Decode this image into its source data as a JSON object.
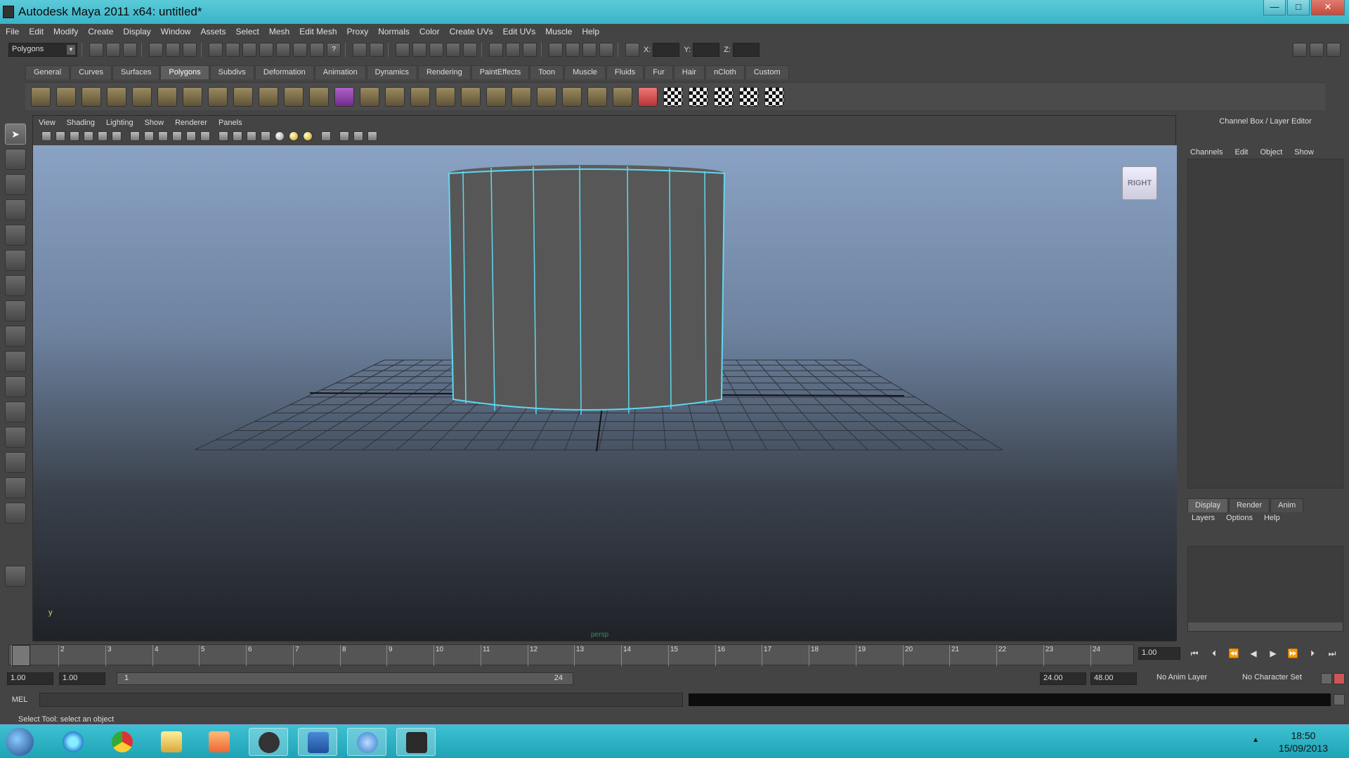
{
  "window": {
    "title": "Autodesk Maya 2011 x64: untitled*",
    "controls": {
      "minimize": "—",
      "maximize": "□",
      "close": "✕"
    }
  },
  "menubar": [
    "File",
    "Edit",
    "Modify",
    "Create",
    "Display",
    "Window",
    "Assets",
    "Select",
    "Mesh",
    "Edit Mesh",
    "Proxy",
    "Normals",
    "Color",
    "Create UVs",
    "Edit UVs",
    "Muscle",
    "Help"
  ],
  "statusline": {
    "menuset": "Polygons",
    "x_label": "X:",
    "y_label": "Y:",
    "z_label": "Z:"
  },
  "shelf": {
    "tabs": [
      "General",
      "Curves",
      "Surfaces",
      "Polygons",
      "Subdivs",
      "Deformation",
      "Animation",
      "Dynamics",
      "Rendering",
      "PaintEffects",
      "Toon",
      "Muscle",
      "Fluids",
      "Fur",
      "Hair",
      "nCloth",
      "Custom"
    ],
    "active_tab": "Polygons"
  },
  "viewport": {
    "menu": [
      "View",
      "Shading",
      "Lighting",
      "Show",
      "Renderer",
      "Panels"
    ],
    "camera_label": "persp",
    "viewcube_label": "RIGHT",
    "axis_label": "y"
  },
  "channelbox": {
    "title": "Channel Box / Layer Editor",
    "menu": [
      "Channels",
      "Edit",
      "Object",
      "Show"
    ]
  },
  "layer_editor": {
    "tabs": [
      "Display",
      "Render",
      "Anim"
    ],
    "active_tab": "Display",
    "menu": [
      "Layers",
      "Options",
      "Help"
    ]
  },
  "timeslider": {
    "frames": [
      "1",
      "2",
      "3",
      "4",
      "5",
      "6",
      "7",
      "8",
      "9",
      "10",
      "11",
      "12",
      "13",
      "14",
      "15",
      "16",
      "17",
      "18",
      "19",
      "20",
      "21",
      "22",
      "23",
      "24"
    ],
    "current_frame": "1.00"
  },
  "rangeslider": {
    "start_time": "1.00",
    "playback_start": "1.00",
    "range_start_label": "1",
    "range_end_label": "24",
    "playback_end": "24.00",
    "end_time": "48.00",
    "anim_layer": "No Anim Layer",
    "character_set": "No Character Set"
  },
  "commandline": {
    "label": "MEL",
    "help_text": "Select Tool: select an object"
  },
  "taskbar": {
    "time": "18:50",
    "date": "15/09/2013"
  },
  "colors": {
    "wireframe_highlight": "#5fd8f0",
    "viewport_sky": "#8aa2c4",
    "viewport_floor": "#1f2227",
    "taskbar": "#2bb2c4"
  }
}
